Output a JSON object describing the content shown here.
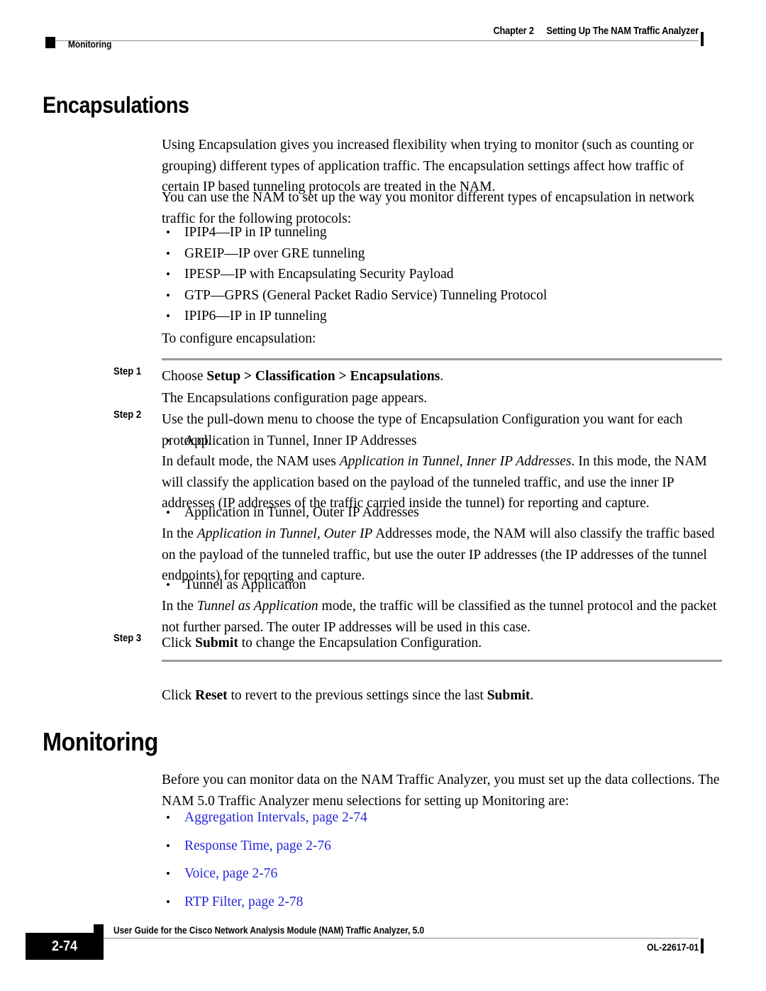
{
  "header": {
    "chapter_number": "Chapter 2",
    "chapter_title": "Setting Up The NAM Traffic Analyzer",
    "section_name": "Monitoring"
  },
  "sections": {
    "encapsulations": {
      "heading": "Encapsulations",
      "intro_para_1": "Using Encapsulation gives you increased flexibility when trying to monitor (such as counting or grouping) different types of application traffic. The encapsulation settings affect how traffic of certain IP based tunneling protocols are treated in the NAM.",
      "intro_para_2": "You can use the NAM to set up the way you monitor different types of encapsulation in network traffic for the following protocols:",
      "protocols": [
        "IPIP4—IP in IP tunneling",
        "GREIP—IP over GRE tunneling",
        "IPESP—IP with Encapsulating Security Payload",
        "GTP—GPRS (General Packet Radio Service) Tunneling Protocol",
        "IPIP6—IP in IP tunneling"
      ],
      "configure_lead_in": "To configure encapsulation:",
      "steps": [
        {
          "label": "Step 1",
          "text_parts": [
            {
              "text": "Choose ",
              "style": "normal"
            },
            {
              "text": "Setup > Classification > Encapsulations",
              "style": "bold"
            },
            {
              "text": ".",
              "style": "normal"
            }
          ],
          "follow_up": "The Encapsulations configuration page appears."
        },
        {
          "label": "Step 2",
          "text_parts": [
            {
              "text": "Use the pull-down menu to choose the type of Encapsulation Configuration you want for each protocol.",
              "style": "normal"
            }
          ],
          "modes": [
            {
              "bullet": "Application in Tunnel, Inner IP Addresses",
              "description_parts": [
                {
                  "text": "In default mode, the NAM uses ",
                  "style": "normal"
                },
                {
                  "text": "Application in Tunnel, Inner IP Addresses",
                  "style": "italic"
                },
                {
                  "text": ". In this mode, the NAM will classify the application based on the payload of the tunneled traffic, and use the inner IP addresses (IP addresses of the traffic carried inside the tunnel) for reporting and capture.",
                  "style": "normal"
                }
              ]
            },
            {
              "bullet": "Application in Tunnel, Outer IP Addresses",
              "description_parts": [
                {
                  "text": "In the ",
                  "style": "normal"
                },
                {
                  "text": "Application in Tunnel, Outer IP",
                  "style": "italic"
                },
                {
                  "text": " Addresses mode, the NAM will also classify the traffic based on the payload of the tunneled traffic, but use the outer IP addresses (the IP addresses of the tunnel endpoints) for reporting and capture.",
                  "style": "normal"
                }
              ]
            },
            {
              "bullet": "Tunnel as Application",
              "description_parts": [
                {
                  "text": "In the ",
                  "style": "normal"
                },
                {
                  "text": "Tunnel as Application",
                  "style": "italic"
                },
                {
                  "text": " mode, the traffic will be classified as the tunnel protocol and the packet not further parsed. The outer IP addresses will be used in this case.",
                  "style": "normal"
                }
              ]
            }
          ]
        },
        {
          "label": "Step 3",
          "text_parts": [
            {
              "text": "Click ",
              "style": "normal"
            },
            {
              "text": "Submit",
              "style": "bold"
            },
            {
              "text": " to change the Encapsulation Configuration.",
              "style": "normal"
            }
          ]
        }
      ],
      "closing_parts": [
        {
          "text": "Click ",
          "style": "normal"
        },
        {
          "text": "Reset",
          "style": "bold"
        },
        {
          "text": " to revert to the previous settings since the last ",
          "style": "normal"
        },
        {
          "text": "Submit",
          "style": "bold"
        },
        {
          "text": ".",
          "style": "normal"
        }
      ]
    },
    "monitoring": {
      "heading": "Monitoring",
      "intro_para": "Before you can monitor data on the NAM Traffic Analyzer, you must set up the data collections. The NAM 5.0 Traffic Analyzer menu selections for setting up Monitoring are:",
      "links": [
        "Aggregation Intervals, page 2-74",
        "Response Time, page 2-76",
        "Voice, page 2-76",
        "RTP Filter, page 2-78"
      ],
      "link_color": "#2828d8"
    }
  },
  "footer": {
    "guide_title": "User Guide for the Cisco Network Analysis Module (NAM) Traffic Analyzer, 5.0",
    "page_number": "2-74",
    "document_number": "OL-22617-01"
  }
}
